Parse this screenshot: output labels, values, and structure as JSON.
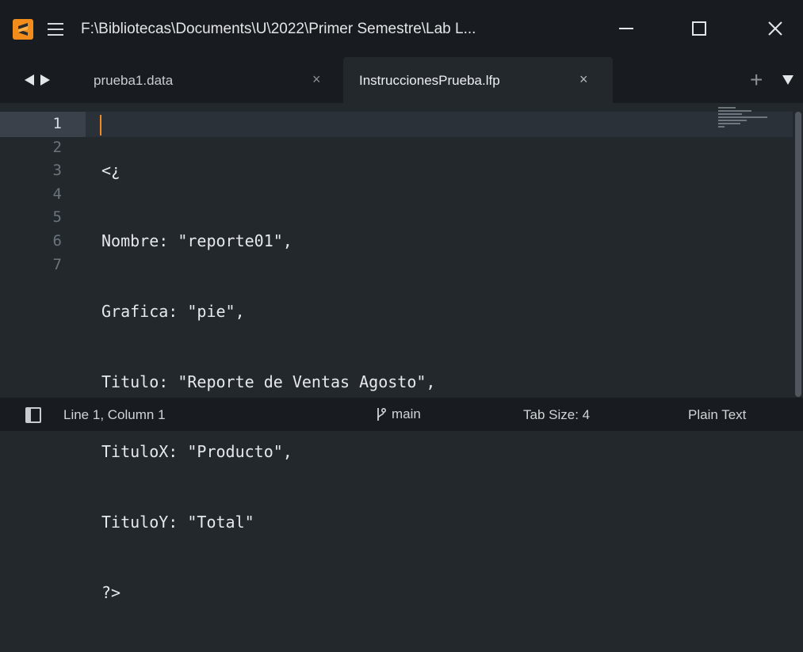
{
  "window": {
    "title": "F:\\Bibliotecas\\Documents\\U\\2022\\Primer Semestre\\Lab L...",
    "app_icon": "sublime-text-icon",
    "menu_icon": "hamburger-menu-icon"
  },
  "tabs": [
    {
      "label": "prueba1.data",
      "active": false,
      "close": "×"
    },
    {
      "label": "InstruccionesPrueba.lfp",
      "active": true,
      "close": "×"
    }
  ],
  "tabbar": {
    "add": "+",
    "dropdown_icon": "triangle-down-icon"
  },
  "editor": {
    "line_numbers": [
      "1",
      "2",
      "3",
      "4",
      "5",
      "6",
      "7"
    ],
    "lines": [
      "<¿",
      "Nombre: \"reporte01\",",
      "Grafica: \"pie\",",
      "Titulo: \"Reporte de Ventas Agosto\",",
      "TituloX: \"Producto\",",
      "TituloY: \"Total\"",
      "?>"
    ],
    "current_line": 1,
    "caret_color": "#f08a24"
  },
  "statusbar": {
    "position": "Line 1, Column 1",
    "branch": "main",
    "tab_size": "Tab Size: 4",
    "syntax": "Plain Text"
  },
  "colors": {
    "background": "#23282d",
    "chrome": "#181b1f",
    "accent": "#f28c1b"
  }
}
